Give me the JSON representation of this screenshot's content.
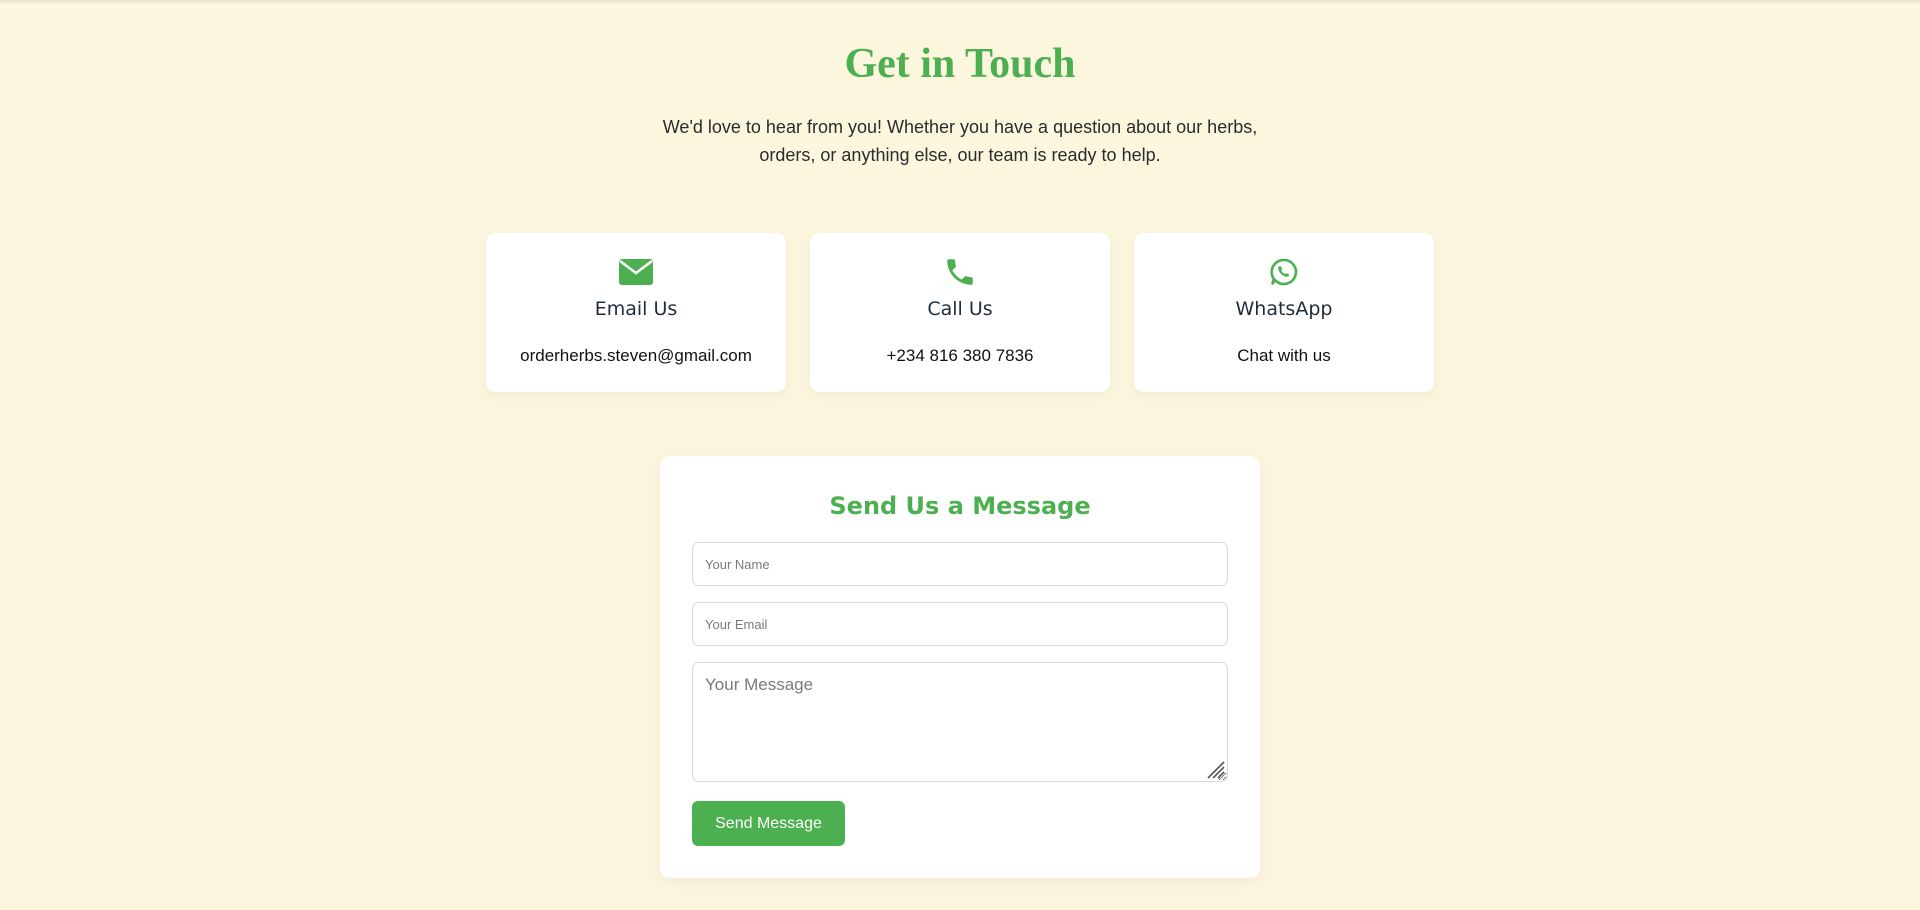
{
  "header": {
    "title": "Get in Touch",
    "intro": "We'd love to hear from you! Whether you have a question about our herbs, orders, or anything else, our team is ready to help."
  },
  "contact_cards": [
    {
      "icon": "envelope-icon",
      "title": "Email Us",
      "value": "orderherbs.steven@gmail.com"
    },
    {
      "icon": "phone-icon",
      "title": "Call Us",
      "value": "+234 816 380 7836"
    },
    {
      "icon": "whatsapp-icon",
      "title": "WhatsApp",
      "value": "Chat with us"
    }
  ],
  "form": {
    "title": "Send Us a Message",
    "name_placeholder": "Your Name",
    "email_placeholder": "Your Email",
    "message_placeholder": "Your Message",
    "submit_label": "Send Message"
  },
  "colors": {
    "background": "#fdf6df",
    "accent": "#4caf50",
    "card": "#ffffff",
    "heading_dark": "#1f2d3d"
  }
}
